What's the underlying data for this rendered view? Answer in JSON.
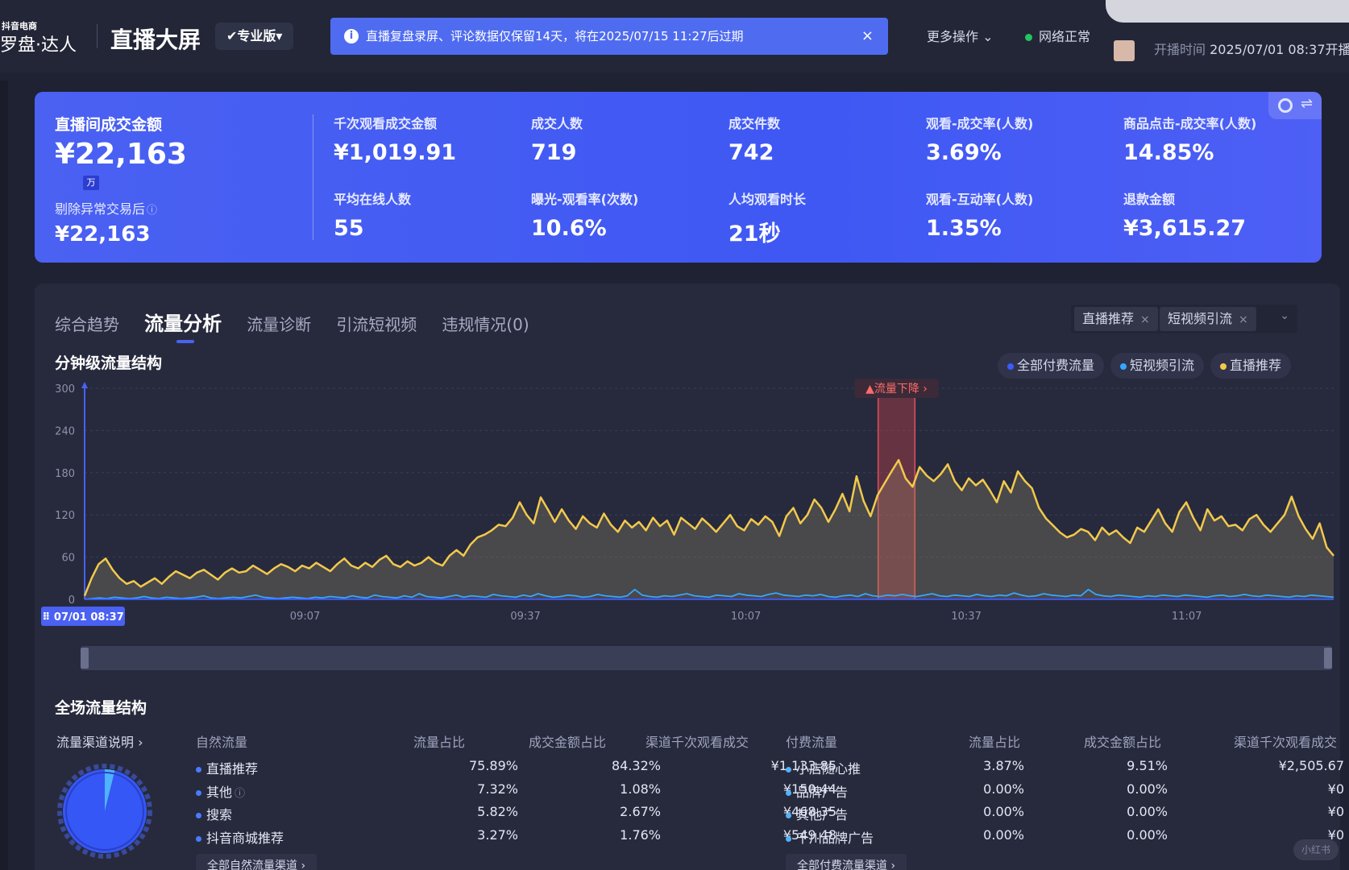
{
  "header": {
    "brand_small": "抖音电商",
    "brand_main": "罗盘·达人",
    "page_title": "直播大屏",
    "version_label": "专业版",
    "notice_icon": "i",
    "notice_text": "直播复盘录屏、评论数据仅保留14天，将在2025/07/15 11:27后过期",
    "notice_close": "×",
    "more_ops_label": "更多操作 ⌄",
    "network_status": "网络正常",
    "live_time_label": "开播时间",
    "live_time_value": "2025/07/01 08:37开播,"
  },
  "kpi": {
    "main_label": "直播间成交金额",
    "main_value": "¥22,163",
    "main_unit": "万",
    "sub_label": "剔除异常交易后",
    "sub_help_icon": "ⓘ",
    "sub_value": "¥22,163",
    "metrics": [
      {
        "label": "千次观看成交金额",
        "value": "¥1,019.91"
      },
      {
        "label": "成交人数",
        "value": "719"
      },
      {
        "label": "成交件数",
        "value": "742"
      },
      {
        "label": "观看-成交率(人数)",
        "value": "3.69%"
      },
      {
        "label": "商品点击-成交率(人数)",
        "value": "14.85%"
      },
      {
        "label": "平均在线人数",
        "value": "55"
      },
      {
        "label": "曝光-观看率(次数)",
        "value": "10.6%"
      },
      {
        "label": "人均观看时长",
        "value": "21秒"
      },
      {
        "label": "观看-互动率(人数)",
        "value": "1.35%"
      },
      {
        "label": "退款金额",
        "value": "¥3,615.27"
      }
    ]
  },
  "tabs": [
    {
      "label": "综合趋势",
      "active": false
    },
    {
      "label": "流量分析",
      "active": true
    },
    {
      "label": "流量诊断",
      "active": false
    },
    {
      "label": "引流短视频",
      "active": false
    },
    {
      "label": "违规情况(0)",
      "active": false
    }
  ],
  "filters": {
    "chips": [
      "直播推荐",
      "短视频引流"
    ],
    "chip_close": "×",
    "dropdown_icon": "⌄"
  },
  "minute_section": {
    "title": "分钟级流量结构",
    "legend": [
      {
        "label": "全部付费流量",
        "color": "#3b5bff"
      },
      {
        "label": "短视频引流",
        "color": "#35a7ff"
      },
      {
        "label": "直播推荐",
        "color": "#f2c94c"
      }
    ],
    "alert_label": "▲流量下降 ›",
    "start_label": "⠿ 07/01 08:37"
  },
  "chart_data": {
    "type": "line",
    "title": "分钟级流量结构",
    "ylim": [
      0,
      300
    ],
    "y_ticks": [
      0,
      60,
      120,
      180,
      240,
      300
    ],
    "x_start_label": "07/01 08:37",
    "x_tick_labels": [
      "09:07",
      "09:37",
      "10:07",
      "10:37",
      "11:07"
    ],
    "x_tick_minutes": [
      30,
      60,
      90,
      120,
      150
    ],
    "x_range_minutes": [
      0,
      170
    ],
    "highlight_range_minutes": [
      108,
      113
    ],
    "grid": true,
    "series": [
      {
        "name": "直播推荐",
        "color": "#f2c94c",
        "values": [
          5,
          30,
          50,
          58,
          42,
          30,
          22,
          26,
          18,
          24,
          30,
          22,
          32,
          40,
          35,
          30,
          38,
          42,
          35,
          28,
          38,
          44,
          38,
          40,
          48,
          42,
          36,
          44,
          50,
          46,
          40,
          48,
          44,
          52,
          46,
          40,
          50,
          58,
          48,
          44,
          52,
          46,
          56,
          62,
          50,
          46,
          54,
          48,
          52,
          60,
          52,
          48,
          62,
          70,
          62,
          78,
          88,
          92,
          98,
          106,
          104,
          116,
          138,
          120,
          108,
          145,
          128,
          110,
          128,
          112,
          100,
          118,
          108,
          102,
          122,
          106,
          96,
          112,
          102,
          110,
          98,
          116,
          104,
          112,
          92,
          116,
          108,
          100,
          115,
          106,
          96,
          108,
          120,
          104,
          98,
          114,
          106,
          118,
          110,
          90,
          118,
          130,
          108,
          120,
          142,
          130,
          110,
          128,
          150,
          125,
          175,
          140,
          118,
          148,
          165,
          182,
          198,
          172,
          160,
          188,
          176,
          168,
          178,
          192,
          168,
          155,
          172,
          162,
          170,
          155,
          138,
          168,
          152,
          182,
          168,
          158,
          130,
          115,
          105,
          95,
          88,
          92,
          100,
          96,
          84,
          102,
          92,
          98,
          88,
          80,
          102,
          96,
          112,
          128,
          108,
          96,
          124,
          138,
          116,
          98,
          128,
          112,
          118,
          104,
          106,
          98,
          114,
          120,
          106,
          96,
          108,
          120,
          146,
          118,
          100,
          86,
          108,
          74,
          62
        ]
      },
      {
        "name": "短视频引流",
        "color": "#35a7ff",
        "values": [
          0,
          1,
          2,
          1,
          3,
          2,
          1,
          2,
          4,
          2,
          1,
          3,
          2,
          1,
          2,
          3,
          5,
          2,
          1,
          2,
          3,
          2,
          4,
          6,
          3,
          2,
          1,
          2,
          3,
          2,
          1,
          3,
          2,
          4,
          3,
          2,
          5,
          3,
          2,
          6,
          4,
          3,
          2,
          5,
          3,
          8,
          4,
          3,
          2,
          4,
          6,
          3,
          5,
          4,
          3,
          7,
          5,
          4,
          3,
          6,
          4,
          8,
          5,
          3,
          4,
          6,
          5,
          3,
          4,
          7,
          5,
          4,
          3,
          5,
          14,
          6,
          4,
          3,
          5,
          4,
          6,
          8,
          5,
          4,
          3,
          6,
          5,
          4,
          8,
          6,
          5,
          4,
          7,
          9,
          6,
          5,
          4,
          6,
          5,
          7,
          4,
          3,
          5,
          6,
          4,
          8,
          5,
          4,
          6,
          5,
          7,
          5,
          4,
          6,
          8,
          5,
          4,
          6,
          5,
          4,
          7,
          5,
          4,
          6,
          5,
          9,
          6,
          4,
          5,
          8,
          6,
          5,
          4,
          6,
          5,
          14,
          7,
          5,
          4,
          6,
          5,
          4,
          3,
          5,
          4,
          6,
          5,
          4,
          6,
          5,
          4,
          3,
          5,
          6,
          4,
          5,
          7,
          5,
          4,
          6,
          5,
          4,
          3,
          5,
          4,
          6,
          5,
          4,
          3
        ]
      },
      {
        "name": "全部付费流量",
        "color": "#3b5bff",
        "values": [
          0,
          0,
          0,
          0,
          0,
          0,
          0,
          0,
          0,
          0,
          0,
          0,
          0,
          0,
          0,
          0,
          0,
          0,
          0,
          0,
          0,
          0,
          0,
          0,
          0,
          0,
          0,
          0,
          0,
          0,
          0,
          0,
          0,
          0,
          0,
          0,
          0,
          0,
          0,
          0,
          0,
          0,
          0,
          0,
          0,
          0,
          0,
          0,
          0,
          0,
          0,
          0,
          0,
          0,
          0,
          0,
          0,
          0,
          0,
          0,
          0,
          0,
          0,
          0,
          0,
          0,
          0,
          0,
          0,
          0,
          0,
          0,
          0,
          0,
          0,
          0,
          0,
          0,
          0,
          0,
          0,
          0,
          0,
          0,
          0,
          0,
          0,
          0,
          0,
          0,
          0,
          0,
          0,
          0,
          0,
          0,
          0,
          0,
          0,
          0,
          0,
          0,
          0,
          0,
          0,
          0,
          0,
          0,
          0,
          0,
          0,
          0,
          0,
          0,
          0,
          0,
          0,
          0,
          0,
          0,
          0,
          0,
          0,
          0,
          0,
          0,
          0,
          0,
          0,
          0,
          0,
          0,
          0,
          0,
          0,
          0,
          0,
          0,
          0,
          0,
          0,
          0,
          0,
          0,
          0,
          0,
          0,
          0,
          0,
          0,
          0,
          0,
          0,
          0,
          0,
          0,
          0,
          0,
          0,
          0,
          0,
          0,
          0,
          0,
          0,
          0,
          0,
          0,
          0,
          0,
          0
        ]
      }
    ]
  },
  "structure": {
    "title": "全场流量结构",
    "help_link": "流量渠道说明 ›",
    "natural": {
      "headers": [
        "自然流量",
        "流量占比",
        "成交金额占比",
        "渠道千次观看成交"
      ],
      "rows": [
        [
          "直播推荐",
          "75.89%",
          "84.32%",
          "¥1,133.85"
        ],
        [
          "其他",
          "7.32%",
          "1.08%",
          "¥150.44"
        ],
        [
          "搜索",
          "5.82%",
          "2.67%",
          "¥468.35"
        ],
        [
          "抖音商城推荐",
          "3.27%",
          "1.76%",
          "¥549.48"
        ]
      ],
      "help_icon": "ⓘ",
      "more_label": "全部自然流量渠道 ›"
    },
    "paid": {
      "headers": [
        "付费流量",
        "流量占比",
        "成交金额占比",
        "渠道千次观看成交"
      ],
      "rows": [
        [
          "小店随心推",
          "3.87%",
          "9.51%",
          "¥2,505.67"
        ],
        [
          "品牌广告",
          "0.00%",
          "0.00%",
          "¥0"
        ],
        [
          "其他广告",
          "0.00%",
          "0.00%",
          "¥0"
        ],
        [
          "千川品牌广告",
          "0.00%",
          "0.00%",
          "¥0"
        ]
      ],
      "more_label": "全部付费流量渠道 ›"
    },
    "donut": {
      "natural_share": 96.13,
      "paid_share": 3.87,
      "natural_color": "#3557f5",
      "paid_color": "#4fb3ff"
    }
  },
  "watermark": "小红书"
}
